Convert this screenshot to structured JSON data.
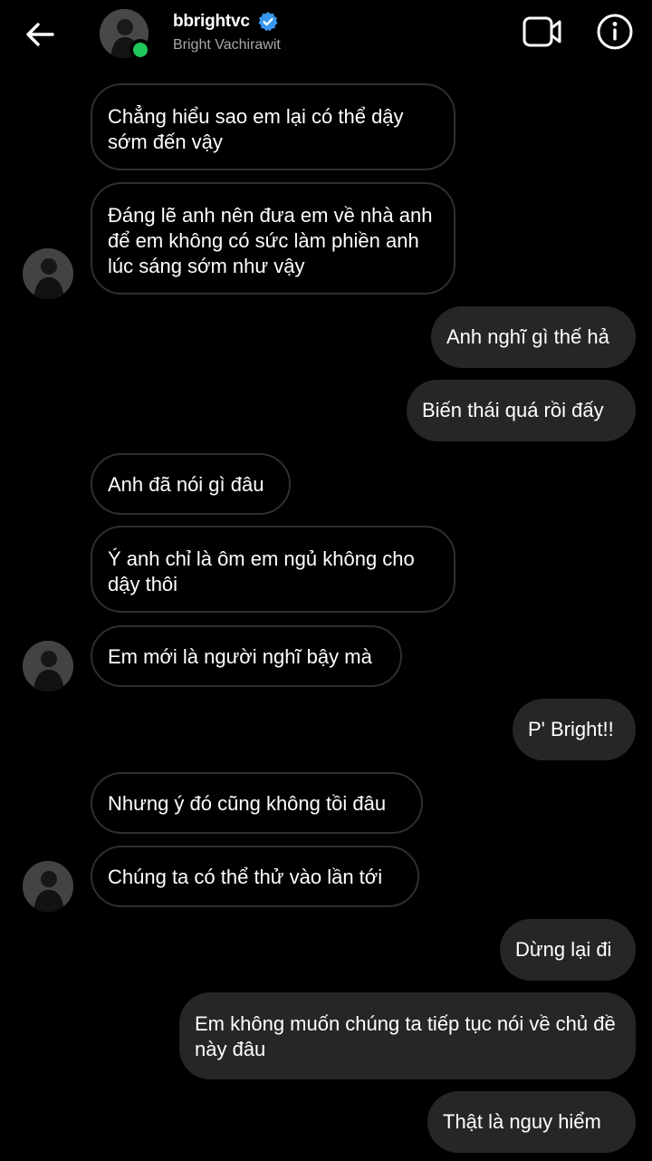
{
  "header": {
    "username": "bbrightvc",
    "full_name": "Bright Vachirawit",
    "back_icon": "back-arrow-icon",
    "verified_icon": "verified-badge-icon",
    "video_icon": "video-call-icon",
    "info_icon": "info-icon",
    "online_color": "#1ec85a",
    "verified_color": "#3897f0"
  },
  "messages": [
    {
      "from": "them",
      "text": "Chẳng hiểu sao em lại có thể dậy sớm đến vậy"
    },
    {
      "from": "them",
      "text": "Đáng lẽ anh nên đưa em về nhà anh để em không có sức làm phiền anh lúc sáng sớm như vậy"
    },
    {
      "from": "me",
      "text": "Anh nghĩ gì thế hả"
    },
    {
      "from": "me",
      "text": "Biến thái quá rồi đấy"
    },
    {
      "from": "them",
      "text": "Anh đã nói gì đâu"
    },
    {
      "from": "them",
      "text": "Ý anh chỉ là ôm em ngủ không cho dậy thôi"
    },
    {
      "from": "them",
      "text": "Em mới là người nghĩ bậy mà"
    },
    {
      "from": "me",
      "text": "P' Bright!!"
    },
    {
      "from": "them",
      "text": "Nhưng ý đó cũng không tồi đâu"
    },
    {
      "from": "them",
      "text": "Chúng ta có thể thử vào lần tới"
    },
    {
      "from": "me",
      "text": "Dừng lại đi"
    },
    {
      "from": "me",
      "text": "Em không muốn chúng ta tiếp tục nói về chủ đề này đâu"
    },
    {
      "from": "me",
      "text": "Thật là nguy hiểm"
    }
  ]
}
